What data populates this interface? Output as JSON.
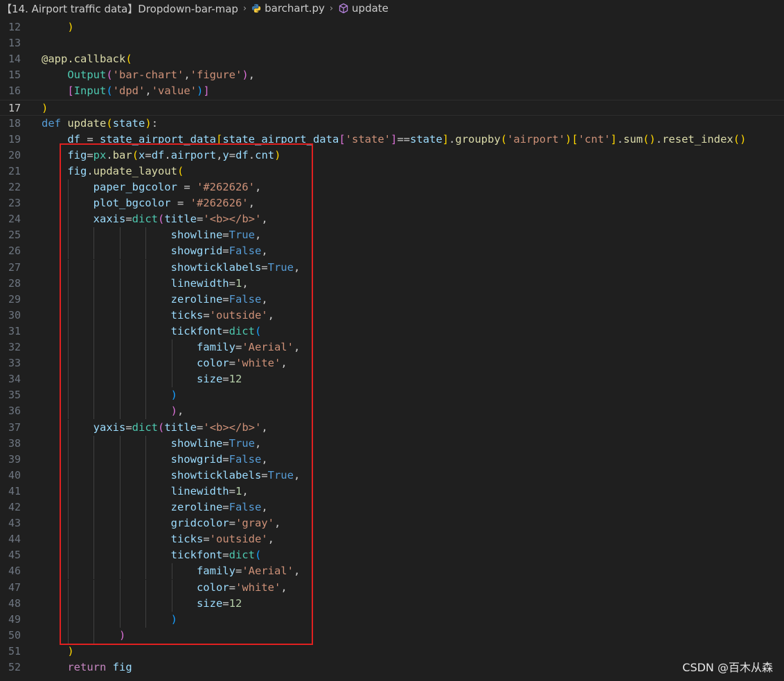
{
  "breadcrumb": {
    "folder": "【14. Airport traffic data】Dropdown-bar-map",
    "file": "barchart.py",
    "symbol": "update",
    "sep": "›"
  },
  "watermark": "CSDN @百木从森",
  "colors": {
    "background": "#1f1f1f",
    "keyword": "#569cd6",
    "control_keyword": "#c586c0",
    "function": "#dcdcaa",
    "string": "#ce9178",
    "variable": "#9cdcfe",
    "number": "#b5cea8",
    "highlight_box": "#e02020"
  },
  "current_line": 17,
  "lines": [
    {
      "n": "12",
      "tokens": [
        [
          "p1",
          "    )"
        ]
      ]
    },
    {
      "n": "13",
      "tokens": []
    },
    {
      "n": "14",
      "tokens": [
        [
          "fn",
          "@app.callback"
        ],
        [
          "p1",
          "("
        ]
      ]
    },
    {
      "n": "15",
      "tokens": [
        [
          "plain",
          "    "
        ],
        [
          "cls",
          "Output"
        ],
        [
          "p2",
          "("
        ],
        [
          "str",
          "'bar-chart'"
        ],
        [
          "plain",
          ","
        ],
        [
          "str",
          "'figure'"
        ],
        [
          "p2",
          ")"
        ],
        [
          "plain",
          ","
        ]
      ]
    },
    {
      "n": "16",
      "tokens": [
        [
          "plain",
          "    "
        ],
        [
          "p2",
          "["
        ],
        [
          "cls",
          "Input"
        ],
        [
          "p3",
          "("
        ],
        [
          "str",
          "'dpd'"
        ],
        [
          "plain",
          ","
        ],
        [
          "str",
          "'value'"
        ],
        [
          "p3",
          ")"
        ],
        [
          "p2",
          "]"
        ]
      ]
    },
    {
      "n": "17",
      "tokens": [
        [
          "p1",
          ")"
        ]
      ]
    },
    {
      "n": "18",
      "tokens": [
        [
          "kw",
          "def"
        ],
        [
          "plain",
          " "
        ],
        [
          "fn",
          "update"
        ],
        [
          "p1",
          "("
        ],
        [
          "var",
          "state"
        ],
        [
          "p1",
          ")"
        ],
        [
          "plain",
          ":"
        ]
      ]
    },
    {
      "n": "19",
      "tokens": [
        [
          "plain",
          "    "
        ],
        [
          "var",
          "df"
        ],
        [
          "plain",
          " = "
        ],
        [
          "var",
          "state_airport_data"
        ],
        [
          "p1",
          "["
        ],
        [
          "var",
          "state_airport_data"
        ],
        [
          "p2",
          "["
        ],
        [
          "str",
          "'state'"
        ],
        [
          "p2",
          "]"
        ],
        [
          "plain",
          "=="
        ],
        [
          "var",
          "state"
        ],
        [
          "p1",
          "]"
        ],
        [
          "plain",
          "."
        ],
        [
          "fn",
          "groupby"
        ],
        [
          "p1",
          "("
        ],
        [
          "str",
          "'airport'"
        ],
        [
          "p1",
          ")"
        ],
        [
          "p1",
          "["
        ],
        [
          "str",
          "'cnt'"
        ],
        [
          "p1",
          "]"
        ],
        [
          "plain",
          "."
        ],
        [
          "fn",
          "sum"
        ],
        [
          "p1",
          "()"
        ],
        [
          "plain",
          "."
        ],
        [
          "fn",
          "reset_index"
        ],
        [
          "p1",
          "()"
        ]
      ]
    },
    {
      "n": "20",
      "tokens": [
        [
          "plain",
          "    "
        ],
        [
          "var",
          "fig"
        ],
        [
          "plain",
          "="
        ],
        [
          "cls",
          "px"
        ],
        [
          "plain",
          "."
        ],
        [
          "fn",
          "bar"
        ],
        [
          "p1",
          "("
        ],
        [
          "var",
          "x"
        ],
        [
          "plain",
          "="
        ],
        [
          "var",
          "df"
        ],
        [
          "plain",
          "."
        ],
        [
          "var",
          "airport"
        ],
        [
          "plain",
          ","
        ],
        [
          "var",
          "y"
        ],
        [
          "plain",
          "="
        ],
        [
          "var",
          "df"
        ],
        [
          "plain",
          "."
        ],
        [
          "var",
          "cnt"
        ],
        [
          "p1",
          ")"
        ]
      ]
    },
    {
      "n": "21",
      "tokens": [
        [
          "plain",
          "    "
        ],
        [
          "var",
          "fig"
        ],
        [
          "plain",
          "."
        ],
        [
          "fn",
          "update_layout"
        ],
        [
          "p1",
          "("
        ]
      ]
    },
    {
      "n": "22",
      "tokens": [
        [
          "plain",
          "        "
        ],
        [
          "var",
          "paper_bgcolor"
        ],
        [
          "plain",
          " = "
        ],
        [
          "str",
          "'#262626'"
        ],
        [
          "plain",
          ","
        ]
      ]
    },
    {
      "n": "23",
      "tokens": [
        [
          "plain",
          "        "
        ],
        [
          "var",
          "plot_bgcolor"
        ],
        [
          "plain",
          " = "
        ],
        [
          "str",
          "'#262626'"
        ],
        [
          "plain",
          ","
        ]
      ]
    },
    {
      "n": "24",
      "tokens": [
        [
          "plain",
          "        "
        ],
        [
          "var",
          "xaxis"
        ],
        [
          "plain",
          "="
        ],
        [
          "cls",
          "dict"
        ],
        [
          "p2",
          "("
        ],
        [
          "var",
          "title"
        ],
        [
          "plain",
          "="
        ],
        [
          "str",
          "'<b></b>'"
        ],
        [
          "plain",
          ","
        ]
      ]
    },
    {
      "n": "25",
      "tokens": [
        [
          "plain",
          "                    "
        ],
        [
          "var",
          "showline"
        ],
        [
          "plain",
          "="
        ],
        [
          "kw",
          "True"
        ],
        [
          "plain",
          ","
        ]
      ]
    },
    {
      "n": "26",
      "tokens": [
        [
          "plain",
          "                    "
        ],
        [
          "var",
          "showgrid"
        ],
        [
          "plain",
          "="
        ],
        [
          "kw",
          "False"
        ],
        [
          "plain",
          ","
        ]
      ]
    },
    {
      "n": "27",
      "tokens": [
        [
          "plain",
          "                    "
        ],
        [
          "var",
          "showticklabels"
        ],
        [
          "plain",
          "="
        ],
        [
          "kw",
          "True"
        ],
        [
          "plain",
          ","
        ]
      ]
    },
    {
      "n": "28",
      "tokens": [
        [
          "plain",
          "                    "
        ],
        [
          "var",
          "linewidth"
        ],
        [
          "plain",
          "="
        ],
        [
          "num",
          "1"
        ],
        [
          "plain",
          ","
        ]
      ]
    },
    {
      "n": "29",
      "tokens": [
        [
          "plain",
          "                    "
        ],
        [
          "var",
          "zeroline"
        ],
        [
          "plain",
          "="
        ],
        [
          "kw",
          "False"
        ],
        [
          "plain",
          ","
        ]
      ]
    },
    {
      "n": "30",
      "tokens": [
        [
          "plain",
          "                    "
        ],
        [
          "var",
          "ticks"
        ],
        [
          "plain",
          "="
        ],
        [
          "str",
          "'outside'"
        ],
        [
          "plain",
          ","
        ]
      ]
    },
    {
      "n": "31",
      "tokens": [
        [
          "plain",
          "                    "
        ],
        [
          "var",
          "tickfont"
        ],
        [
          "plain",
          "="
        ],
        [
          "cls",
          "dict"
        ],
        [
          "p3",
          "("
        ]
      ]
    },
    {
      "n": "32",
      "tokens": [
        [
          "plain",
          "                        "
        ],
        [
          "var",
          "family"
        ],
        [
          "plain",
          "="
        ],
        [
          "str",
          "'Aerial'"
        ],
        [
          "plain",
          ","
        ]
      ]
    },
    {
      "n": "33",
      "tokens": [
        [
          "plain",
          "                        "
        ],
        [
          "var",
          "color"
        ],
        [
          "plain",
          "="
        ],
        [
          "str",
          "'white'"
        ],
        [
          "plain",
          ","
        ]
      ]
    },
    {
      "n": "34",
      "tokens": [
        [
          "plain",
          "                        "
        ],
        [
          "var",
          "size"
        ],
        [
          "plain",
          "="
        ],
        [
          "num",
          "12"
        ]
      ]
    },
    {
      "n": "35",
      "tokens": [
        [
          "plain",
          "                    "
        ],
        [
          "p3",
          ")"
        ]
      ]
    },
    {
      "n": "36",
      "tokens": [
        [
          "plain",
          "                    "
        ],
        [
          "p2",
          ")"
        ],
        [
          "plain",
          ","
        ]
      ]
    },
    {
      "n": "37",
      "tokens": [
        [
          "plain",
          "        "
        ],
        [
          "var",
          "yaxis"
        ],
        [
          "plain",
          "="
        ],
        [
          "cls",
          "dict"
        ],
        [
          "p2",
          "("
        ],
        [
          "var",
          "title"
        ],
        [
          "plain",
          "="
        ],
        [
          "str",
          "'<b></b>'"
        ],
        [
          "plain",
          ","
        ]
      ]
    },
    {
      "n": "38",
      "tokens": [
        [
          "plain",
          "                    "
        ],
        [
          "var",
          "showline"
        ],
        [
          "plain",
          "="
        ],
        [
          "kw",
          "True"
        ],
        [
          "plain",
          ","
        ]
      ]
    },
    {
      "n": "39",
      "tokens": [
        [
          "plain",
          "                    "
        ],
        [
          "var",
          "showgrid"
        ],
        [
          "plain",
          "="
        ],
        [
          "kw",
          "False"
        ],
        [
          "plain",
          ","
        ]
      ]
    },
    {
      "n": "40",
      "tokens": [
        [
          "plain",
          "                    "
        ],
        [
          "var",
          "showticklabels"
        ],
        [
          "plain",
          "="
        ],
        [
          "kw",
          "True"
        ],
        [
          "plain",
          ","
        ]
      ]
    },
    {
      "n": "41",
      "tokens": [
        [
          "plain",
          "                    "
        ],
        [
          "var",
          "linewidth"
        ],
        [
          "plain",
          "="
        ],
        [
          "num",
          "1"
        ],
        [
          "plain",
          ","
        ]
      ]
    },
    {
      "n": "42",
      "tokens": [
        [
          "plain",
          "                    "
        ],
        [
          "var",
          "zeroline"
        ],
        [
          "plain",
          "="
        ],
        [
          "kw",
          "False"
        ],
        [
          "plain",
          ","
        ]
      ]
    },
    {
      "n": "43",
      "tokens": [
        [
          "plain",
          "                    "
        ],
        [
          "var",
          "gridcolor"
        ],
        [
          "plain",
          "="
        ],
        [
          "str",
          "'gray'"
        ],
        [
          "plain",
          ","
        ]
      ]
    },
    {
      "n": "44",
      "tokens": [
        [
          "plain",
          "                    "
        ],
        [
          "var",
          "ticks"
        ],
        [
          "plain",
          "="
        ],
        [
          "str",
          "'outside'"
        ],
        [
          "plain",
          ","
        ]
      ]
    },
    {
      "n": "45",
      "tokens": [
        [
          "plain",
          "                    "
        ],
        [
          "var",
          "tickfont"
        ],
        [
          "plain",
          "="
        ],
        [
          "cls",
          "dict"
        ],
        [
          "p3",
          "("
        ]
      ]
    },
    {
      "n": "46",
      "tokens": [
        [
          "plain",
          "                        "
        ],
        [
          "var",
          "family"
        ],
        [
          "plain",
          "="
        ],
        [
          "str",
          "'Aerial'"
        ],
        [
          "plain",
          ","
        ]
      ]
    },
    {
      "n": "47",
      "tokens": [
        [
          "plain",
          "                        "
        ],
        [
          "var",
          "color"
        ],
        [
          "plain",
          "="
        ],
        [
          "str",
          "'white'"
        ],
        [
          "plain",
          ","
        ]
      ]
    },
    {
      "n": "48",
      "tokens": [
        [
          "plain",
          "                        "
        ],
        [
          "var",
          "size"
        ],
        [
          "plain",
          "="
        ],
        [
          "num",
          "12"
        ]
      ]
    },
    {
      "n": "49",
      "tokens": [
        [
          "plain",
          "                    "
        ],
        [
          "p3",
          ")"
        ]
      ]
    },
    {
      "n": "50",
      "tokens": [
        [
          "plain",
          "            "
        ],
        [
          "p2",
          ")"
        ]
      ]
    },
    {
      "n": "51",
      "tokens": [
        [
          "plain",
          "    "
        ],
        [
          "p1",
          ")"
        ]
      ]
    },
    {
      "n": "52",
      "tokens": [
        [
          "plain",
          "    "
        ],
        [
          "kw2",
          "return"
        ],
        [
          "plain",
          " "
        ],
        [
          "var",
          "fig"
        ]
      ]
    }
  ]
}
